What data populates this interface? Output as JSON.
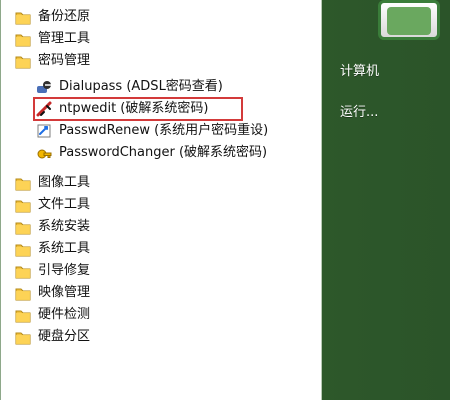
{
  "programs": [
    {
      "label": "备份还原",
      "icon": "folder-icon",
      "level": 0
    },
    {
      "label": "管理工具",
      "icon": "folder-icon",
      "level": 0
    },
    {
      "label": "密码管理",
      "icon": "folder-icon",
      "level": 0
    },
    {
      "label": "Dialupass (ADSL密码查看)",
      "icon": "dialupass-icon",
      "level": 1
    },
    {
      "label": "ntpwedit (破解系统密码)",
      "icon": "ntpwedit-icon",
      "level": 1
    },
    {
      "label": "PasswdRenew (系统用户密码重设)",
      "icon": "passwdrenew-icon",
      "level": 1
    },
    {
      "label": "PasswordChanger (破解系统密码)",
      "icon": "passwordchanger-icon",
      "level": 1
    },
    {
      "label": "图像工具",
      "icon": "folder-icon",
      "level": 0
    },
    {
      "label": "文件工具",
      "icon": "folder-icon",
      "level": 0
    },
    {
      "label": "系统安装",
      "icon": "folder-icon",
      "level": 0
    },
    {
      "label": "系统工具",
      "icon": "folder-icon",
      "level": 0
    },
    {
      "label": "引导修复",
      "icon": "folder-icon",
      "level": 0
    },
    {
      "label": "映像管理",
      "icon": "folder-icon",
      "level": 0
    },
    {
      "label": "硬件检测",
      "icon": "folder-icon",
      "level": 0
    },
    {
      "label": "硬盘分区",
      "icon": "folder-icon",
      "level": 0
    }
  ],
  "right_panel": {
    "computer_label": "计算机",
    "run_label": "运行..."
  },
  "colors": {
    "highlight_border": "#d33a3a",
    "right_bg": "#2f5a2b",
    "left_bg": "#ffffff"
  }
}
